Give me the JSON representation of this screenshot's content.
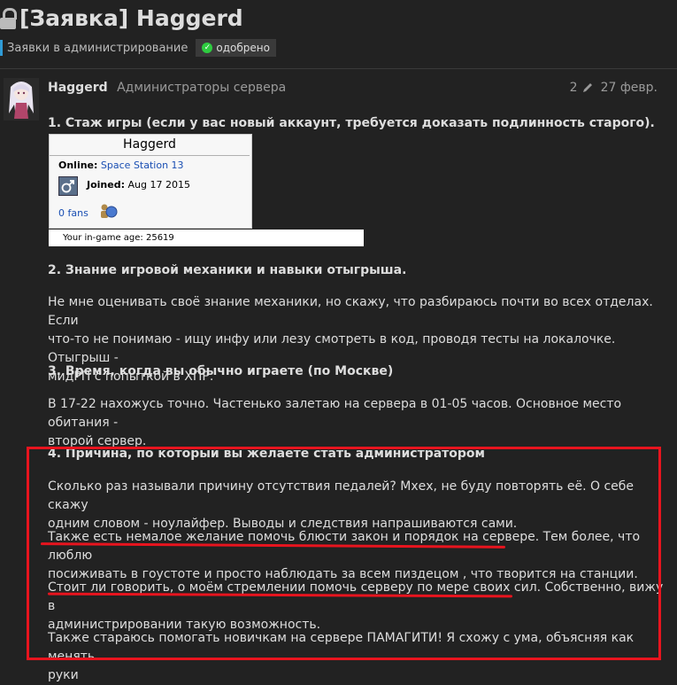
{
  "topic": {
    "prefix": "[Заявка]",
    "name": "Haggerd",
    "category": "Заявки в администрирование",
    "tag": "одобрено"
  },
  "post": {
    "username": "Haggerd",
    "user_title": "Администраторы сервера",
    "edit_count": "2",
    "date": "27 февр."
  },
  "byond_card": {
    "name": "Haggerd",
    "online_label": "Online:",
    "online_value": "Space Station 13",
    "joined_label": "Joined:",
    "joined_value": "Aug 17 2015",
    "fans": "0 fans",
    "age_text": "Your in-game age: 25619"
  },
  "content": {
    "h1": "1. Стаж игры (если у вас новый аккаунт, требуется доказать подлинность старого).",
    "h2": "2. Знание игровой механики и навыки отыгрыша.",
    "p2_l1": "Не мне оценивать своё знание механики, но скажу, что разбираюсь почти во всех отделах. Если",
    "p2_l2": "что-то не понимаю - ищу инфу или лезу смотреть в код, проводя тесты на локалочке. Отыгрыш -",
    "p2_l3": "мидРП с попыткой в ХПР.",
    "h3": "3. Время, когда вы обычно играете (по Москве)",
    "p3_l1": "В 17-22 нахожусь точно. Частенько залетаю на сервера в 01-05 часов. Основное место обитания -",
    "p3_l2": "второй сервер.",
    "h4": "4. Причина, по который вы желаете стать администратором",
    "p4_l1": "Сколько раз называли причину отсутствия педалей? Мхех, не буду повторять её. О себе скажу",
    "p4_l2": "одним словом - ноулайфер. Выводы и следствия напрашиваются сами.",
    "p5_l1": "Также есть немалое желание помочь блюсти закон и порядок на сервере. Тем более, что люблю",
    "p5_l2": "посиживать в гоустоте и просто наблюдать за всем пиздецом , что творится на станции.",
    "p6_l1": "Стоит ли говорить, о моём стремлении помочь серверу по мере своих сил. Собственно, вижу в",
    "p6_l2": "администрировании такую возможность.",
    "p7_l1": "Также стараюсь помогать новичкам на сервере ПАМАГИТИ! Я схожу с ума, объясняя как менять",
    "p7_l2": "руки"
  },
  "colors": {
    "background": "#222222",
    "highlight": "#e8141e",
    "category_bar": "#2f9bd6",
    "approved": "#2ecc40"
  }
}
